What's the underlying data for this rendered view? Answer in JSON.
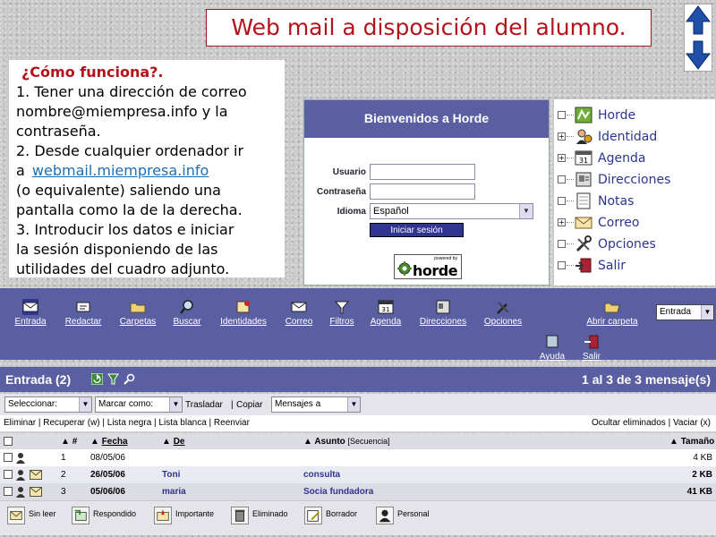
{
  "slide": {
    "title": "Web mail a disposición del alumno."
  },
  "explain": {
    "heading": "¿Cómo funciona?.",
    "lines": [
      "1. Tener una dirección de correo",
      "nombre@miempresa.info y la",
      "contraseña.",
      "2. Desde cualquier ordenador ir",
      "a",
      "webmail.miempresa.info",
      "(o equivalente) saliendo una",
      "pantalla como la de la derecha.",
      "3. Introducir los datos e iniciar",
      "la sesión disponiendo de las",
      "utilidades del cuadro adjunto."
    ]
  },
  "login": {
    "welcome": "Bienvenidos a Horde",
    "user_label": "Usuario",
    "password_label": "Contraseña",
    "language_label": "Idioma",
    "language_value": "Español",
    "submit_label": "Iniciar sesión",
    "powered_small": "powered by",
    "powered_brand": "horde"
  },
  "tree": [
    {
      "label": "Horde",
      "expander": "",
      "icon": "horde-icon"
    },
    {
      "label": "Identidad",
      "expander": "+",
      "icon": "identity-icon"
    },
    {
      "label": "Agenda",
      "expander": "+",
      "icon": "calendar-icon"
    },
    {
      "label": "Direcciones",
      "expander": "",
      "icon": "address-book-icon"
    },
    {
      "label": "Notas",
      "expander": "",
      "icon": "notes-icon"
    },
    {
      "label": "Correo",
      "expander": "+",
      "icon": "mail-icon"
    },
    {
      "label": "Opciones",
      "expander": "",
      "icon": "options-icon"
    },
    {
      "label": "Salir",
      "expander": "",
      "icon": "logout-icon"
    }
  ],
  "toolbar": {
    "items": [
      "Entrada",
      "Redactar",
      "Carpetas",
      "Buscar",
      "Identidades",
      "Correo",
      "Filtros",
      "Agenda",
      "Direcciones",
      "Opciones",
      "Abrir carpeta"
    ],
    "bottom": [
      "Ayuda",
      "Salir"
    ],
    "mailbox_value": "Entrada"
  },
  "header": {
    "title": "Entrada (2)",
    "count": "1 al 3 de 3 mensaje(s)"
  },
  "actions": {
    "select_label": "Seleccionar:",
    "mark_label": "Marcar como:",
    "move_label": "Trasladar",
    "copy_label": "Copiar",
    "target_label": "Mensajes a",
    "sep": "|",
    "left_links": "Eliminar | Recuperar (w) | Lista negra | Lista blanca | Reenviar",
    "right_links": "Ocultar eliminados | Vaciar (x)"
  },
  "table": {
    "headers": {
      "num": "#",
      "date": "Fecha",
      "from": "De",
      "subject": "Asunto",
      "thread": "[Secuencia]",
      "size": "Tamaño"
    },
    "rows": [
      {
        "num": "1",
        "date": "08/05/06",
        "from": "",
        "subject": "",
        "size": "4 KB"
      },
      {
        "num": "2",
        "date": "26/05/06",
        "from": "Toni",
        "subject": "consulta",
        "size": "2 KB"
      },
      {
        "num": "3",
        "date": "05/06/06",
        "from": "maria",
        "subject": "Socia fundadora",
        "size": "41 KB"
      }
    ]
  },
  "legend": [
    "Sin leer",
    "Respondido",
    "Importante",
    "Eliminado",
    "Borrador",
    "Personal"
  ]
}
